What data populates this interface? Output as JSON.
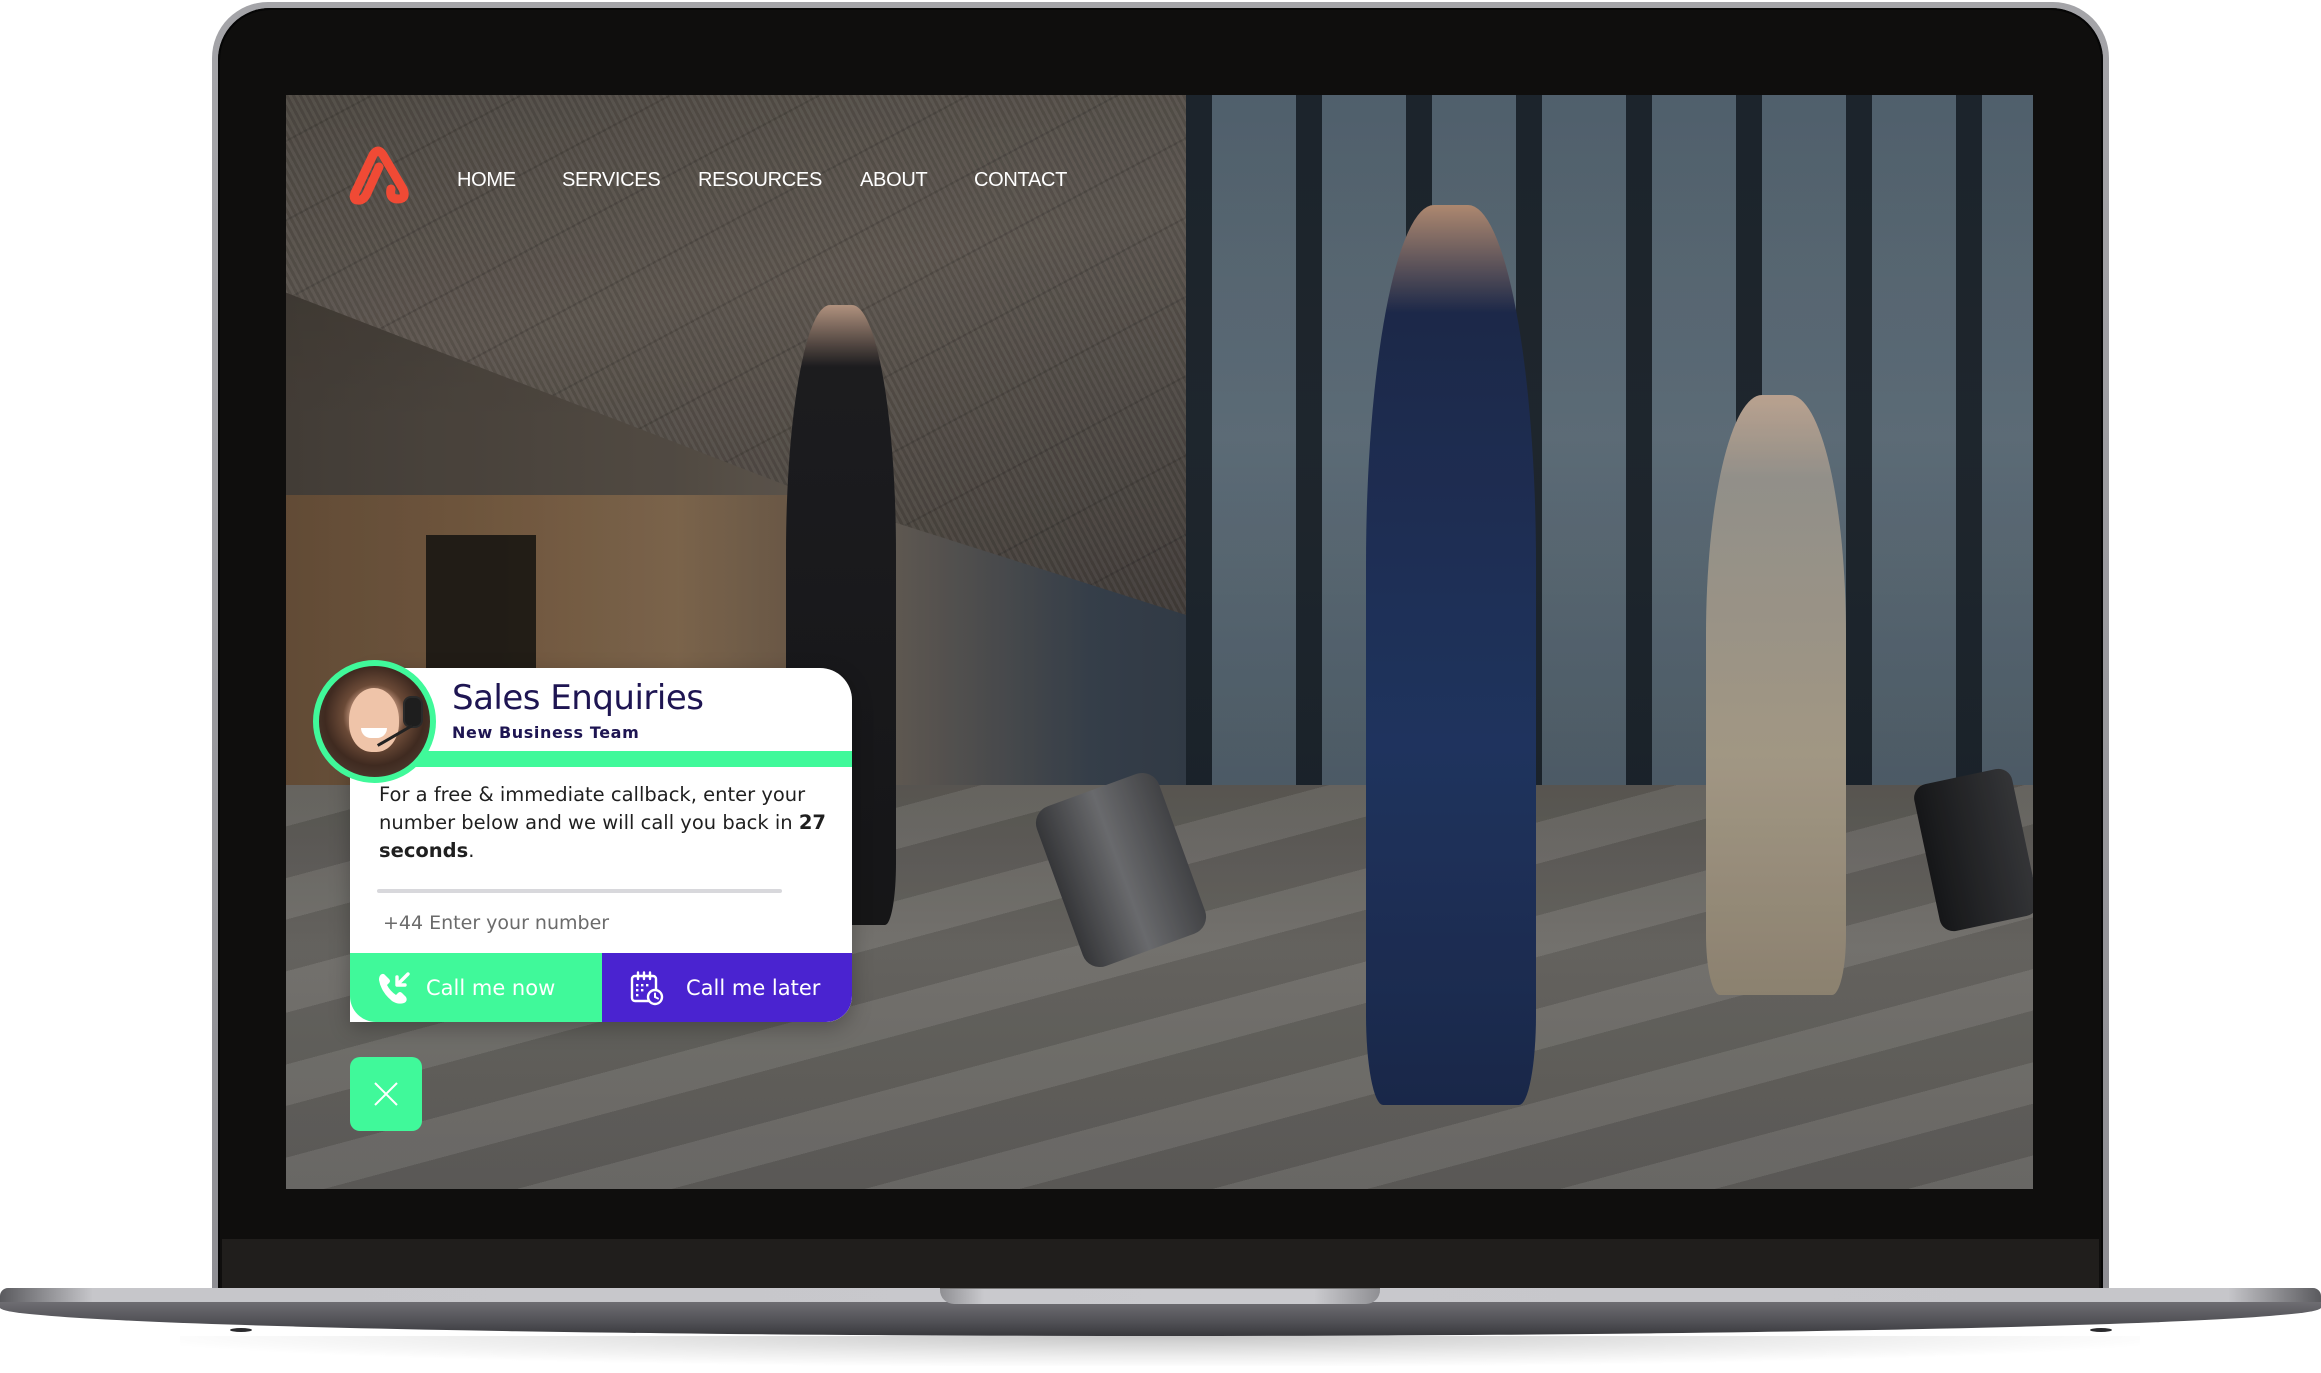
{
  "site": {
    "brand_color": "#F04A35",
    "logo_name": "brand-logo"
  },
  "nav": {
    "items": [
      {
        "label": "HOME"
      },
      {
        "label": "SERVICES"
      },
      {
        "label": "RESOURCES"
      },
      {
        "label": "ABOUT"
      },
      {
        "label": "CONTACT"
      }
    ]
  },
  "widget": {
    "title": "Sales Enquiries",
    "subtitle": "New Business Team",
    "body_prefix": "For a free & immediate callback, enter your number below and we will call you back in ",
    "body_emphasis": "27 seconds",
    "body_suffix": ".",
    "phone_placeholder": "+44 Enter your number",
    "phone_value": "",
    "call_now_label": "Call me now",
    "call_later_label": "Call me later",
    "colors": {
      "accent_green": "#40F99A",
      "accent_purple": "#4A23D0",
      "title_navy": "#1E1552"
    }
  }
}
